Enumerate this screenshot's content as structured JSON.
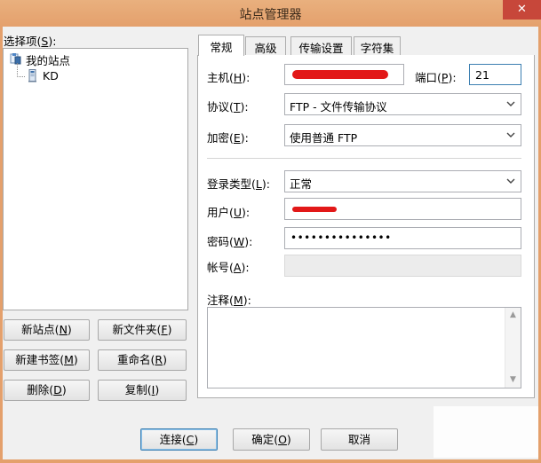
{
  "window": {
    "title": "站点管理器",
    "close_glyph": "✕"
  },
  "left": {
    "select_label_pre": "选择项(",
    "select_label_key": "S",
    "select_label_post": "):",
    "tree": {
      "root": "我的站点",
      "children": [
        "KD"
      ]
    },
    "buttons": {
      "new_site": {
        "pre": "新站点(",
        "key": "N",
        "post": ")"
      },
      "new_folder": {
        "pre": "新文件夹(",
        "key": "F",
        "post": ")"
      },
      "new_bookmark": {
        "pre": "新建书签(",
        "key": "M",
        "post": ")"
      },
      "rename": {
        "pre": "重命名(",
        "key": "R",
        "post": ")"
      },
      "delete": {
        "pre": "删除(",
        "key": "D",
        "post": ")"
      },
      "copy": {
        "pre": "复制(",
        "key": "I",
        "post": ")"
      }
    }
  },
  "tabs": [
    "常规",
    "高级",
    "传输设置",
    "字符集"
  ],
  "general": {
    "host": {
      "pre": "主机(",
      "key": "H",
      "post": "):"
    },
    "port": {
      "pre": "端口(",
      "key": "P",
      "post": "):",
      "value": "21"
    },
    "protocol": {
      "pre": "协议(",
      "key": "T",
      "post": "):",
      "value": "FTP - 文件传输协议"
    },
    "encryption": {
      "pre": "加密(",
      "key": "E",
      "post": "):",
      "value": "使用普通 FTP"
    },
    "logon_type": {
      "pre": "登录类型(",
      "key": "L",
      "post": "):",
      "value": "正常"
    },
    "user": {
      "pre": "用户(",
      "key": "U",
      "post": "):"
    },
    "password": {
      "pre": "密码(",
      "key": "W",
      "post": "):",
      "value": "•••••••••••••••"
    },
    "account": {
      "pre": "帐号(",
      "key": "A",
      "post": "):"
    },
    "comments": {
      "pre": "注释(",
      "key": "M",
      "post": "):"
    }
  },
  "footer": {
    "connect": {
      "pre": "连接(",
      "key": "C",
      "post": ")"
    },
    "ok": {
      "pre": "确定(",
      "key": "O",
      "post": ")"
    },
    "cancel": {
      "label": "取消"
    }
  },
  "colors": {
    "title_bar": "#e4a06c",
    "close_button": "#c7473a",
    "redaction": "#e21818",
    "focus_border": "#3c7fb1"
  },
  "icons": {
    "root": "folder-site-icon",
    "child": "server-icon",
    "dropdown": "chevron-down-icon"
  }
}
